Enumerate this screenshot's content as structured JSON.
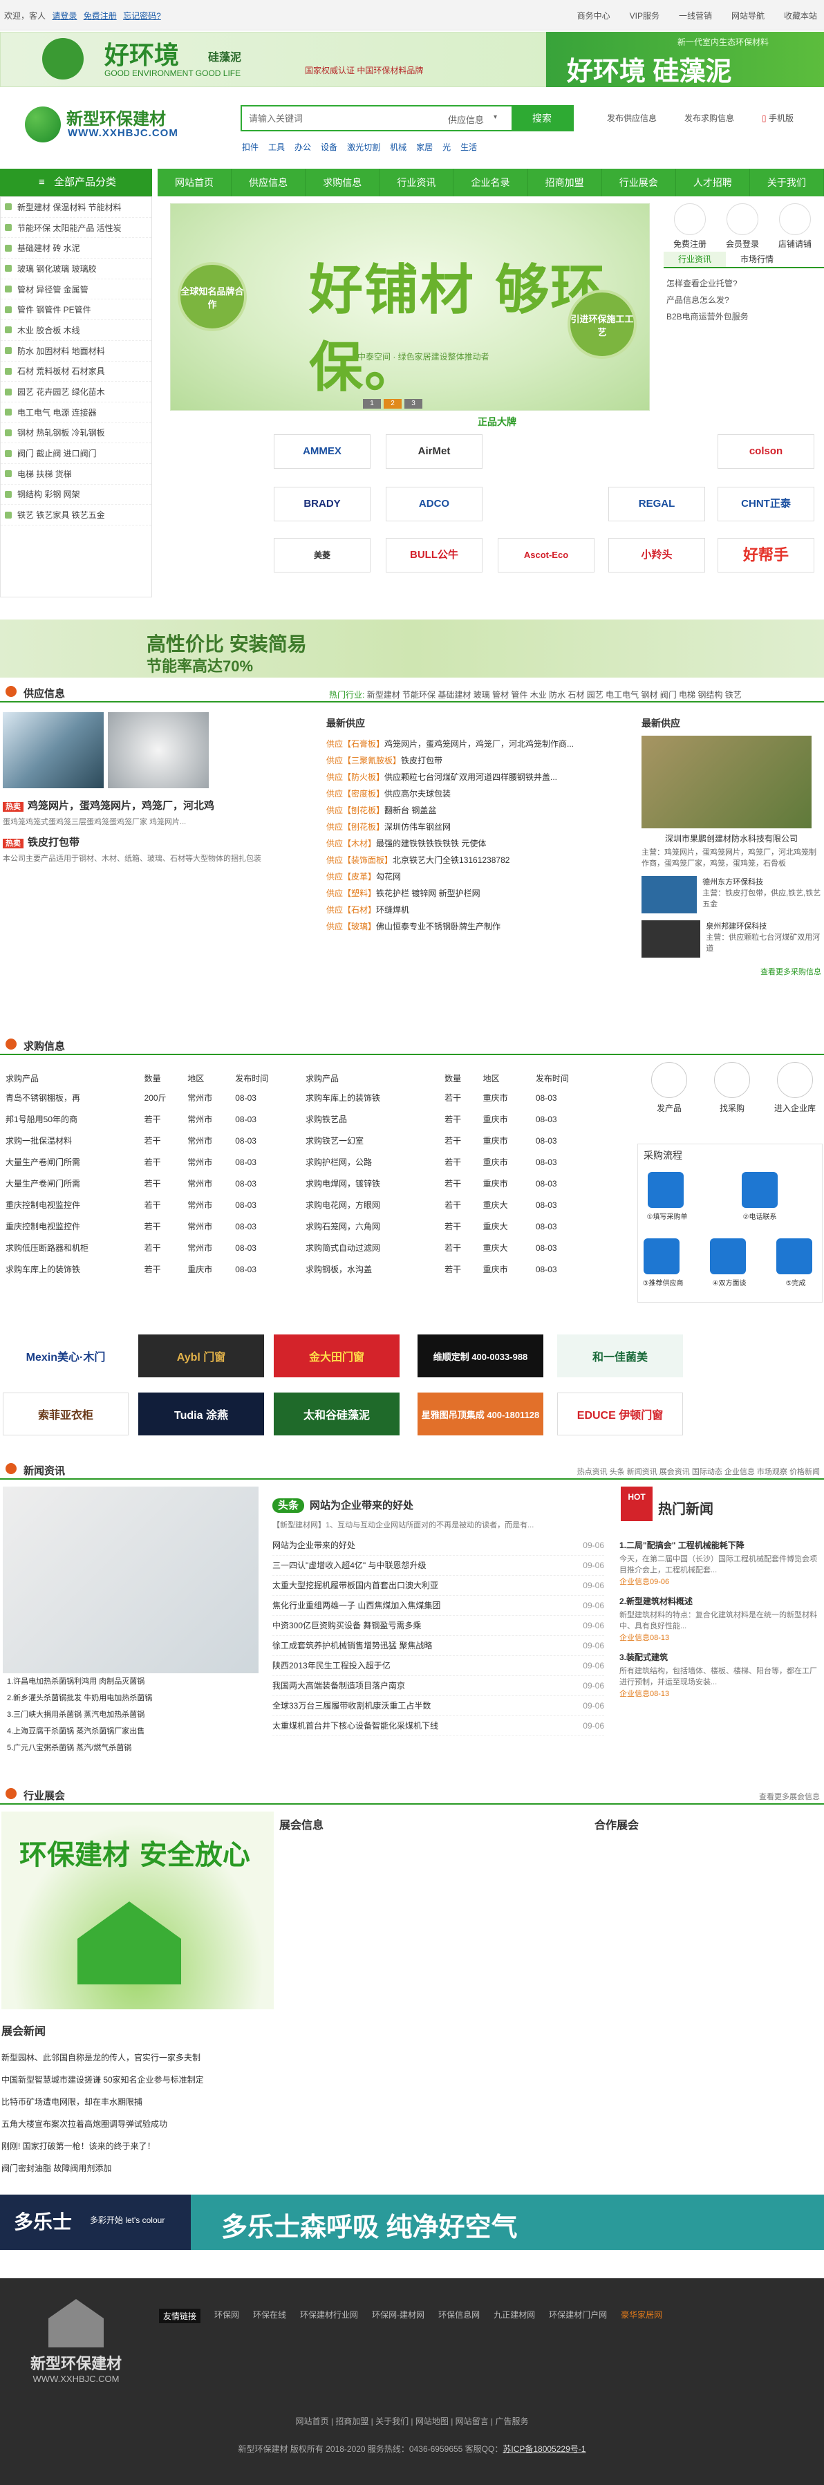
{
  "topbar": {
    "welcome": "欢迎，客人",
    "login": "请登录",
    "register": "免费注册",
    "forgot": "忘记密码?",
    "links": [
      "商务中心",
      "VIP服务",
      "一线营销",
      "网站导航",
      "收藏本站"
    ]
  },
  "ad_top": {
    "left_brand": "好环境",
    "left_sub": "硅藻泥",
    "left_en": "GOOD ENVIRONMENT GOOD LIFE",
    "left_note": "国家权威认证 中国环保材料品牌",
    "right_title": "好环境  硅藻泥",
    "right_sub": "新一代室内生态环保材料"
  },
  "header": {
    "logo_name": "新型环保建材",
    "logo_url": "WWW.XXHBJC.COM",
    "search_placeholder": "请输入关键词",
    "search_select": "供应信息",
    "search_btn": "搜索",
    "hot": [
      "扣件",
      "工具",
      "办公",
      "设备",
      "激光切割",
      "机械",
      "家居",
      "光",
      "生活"
    ],
    "actions": [
      "发布供应信息",
      "发布求购信息",
      "手机版"
    ]
  },
  "nav": {
    "category": "全部产品分类",
    "items": [
      "网站首页",
      "供应信息",
      "求购信息",
      "行业资讯",
      "企业名录",
      "招商加盟",
      "行业展会",
      "人才招聘",
      "关于我们"
    ]
  },
  "sidebar": [
    {
      "label": "新型建材  保温材料  节能材料"
    },
    {
      "label": "节能环保  太阳能产品  活性炭"
    },
    {
      "label": "基础建材  砖  水泥"
    },
    {
      "label": "玻璃  钢化玻璃  玻璃胶"
    },
    {
      "label": "管材  异径管  金属管"
    },
    {
      "label": "管件  钢管件  PE管件"
    },
    {
      "label": "木业  胶合板  木线"
    },
    {
      "label": "防水  加固材料  地面材料"
    },
    {
      "label": "石材  荒料板材  石材家具"
    },
    {
      "label": "园艺  花卉园艺  绿化苗木"
    },
    {
      "label": "电工电气  电源  连接器"
    },
    {
      "label": "钢材  热轧钢板  冷轧钢板"
    },
    {
      "label": "阀门  截止阀  进口阀门"
    },
    {
      "label": "电梯  扶梯  货梯"
    },
    {
      "label": "钢结构  彩钢  网架"
    },
    {
      "label": "铁艺  铁艺家具  铁艺五金"
    }
  ],
  "banner": {
    "headline": "好铺材  够环保。",
    "sub": "中泰空间 · 绿色家居建设整体推动者",
    "left_circle": "全球知名品牌合作",
    "right_circle": "引进环保施工工艺",
    "dots": [
      "1",
      "2",
      "3"
    ]
  },
  "right_box": {
    "icons": [
      "免费注册",
      "会员登录",
      "店铺请铺"
    ],
    "tabs": [
      "行业资讯",
      "市场行情"
    ],
    "items": [
      "怎样查看企业托管?",
      "产品信息怎么发?",
      "B2B电商运营外包服务"
    ]
  },
  "brands_title": "正品大牌",
  "brands": [
    "AMMEX",
    "AirMet",
    "colson",
    "BRADY",
    "ADCO",
    "REGAL",
    "CHNT正泰",
    "美菱",
    "BULL公牛",
    "Ascot-Eco",
    "小羚头",
    "好帮手"
  ],
  "ad_strip": {
    "l1": "高性价比  安装简易",
    "l2": "节能率高达70%"
  },
  "supply": {
    "title": "供应信息",
    "hot_label": "热门行业:",
    "hot": [
      "新型建材",
      "节能环保",
      "基础建材",
      "玻璃",
      "管材",
      "管件",
      "木业",
      "防水",
      "石材",
      "园艺",
      "电工电气",
      "钢材",
      "阀门",
      "电梯",
      "钢结构",
      "铁艺"
    ],
    "featured": [
      {
        "tag": "热卖",
        "title": "鸡笼网片，蛋鸡笼网片，鸡笼厂，河北鸡",
        "desc": "蛋鸡笼鸡笼式蛋鸡笼三层蛋鸡笼蛋鸡笼厂家 鸡笼网片..."
      },
      {
        "tag": "热卖",
        "title": "铁皮打包带",
        "desc": "本公司主要产品适用于钢材、木材、纸箱、玻璃、石材等大型物体的捆扎包装"
      }
    ],
    "latest_title": "最新供应",
    "latest": [
      {
        "cat": "石膏板",
        "t": "鸡笼网片，蛋鸡笼网片，鸡笼厂，河北鸡笼制作商..."
      },
      {
        "cat": "三聚氰胺板",
        "t": "铁皮打包带"
      },
      {
        "cat": "防火板",
        "t": "供应颗粒七台河煤矿双用河道四样腰钢铁井盖..."
      },
      {
        "cat": "密度板",
        "t": "供应高尔夫球包装"
      },
      {
        "cat": "刨花板",
        "t": "翻新台 钢盖盆"
      },
      {
        "cat": "刨花板",
        "t": "深圳仿伟车钢丝网"
      },
      {
        "cat": "木材",
        "t": "最强的建铁铁铁铁铁铁 元使体"
      },
      {
        "cat": "装饰面板",
        "t": "北京铁艺大门全铁13161238782"
      },
      {
        "cat": "皮革",
        "t": "勾花网"
      },
      {
        "cat": "塑料",
        "t": "铁花护栏 镀锌网 新型护栏网"
      },
      {
        "cat": "石材",
        "t": "环缝焊机"
      },
      {
        "cat": "玻璃",
        "t": "佛山恒泰专业不锈钢卧牌生产制作"
      }
    ],
    "right_title": "最新供应",
    "right_main": "深圳市果鹏创建材防水科技有限公司",
    "right_desc": "主营：鸡笼网片，蛋鸡笼网片，鸡笼厂，河北鸡笼制作商，蛋鸡笼厂家，鸡笼，蛋鸡笼，石骨板",
    "right_items": [
      {
        "n": "德州东方环保科技",
        "d": "主营：铁皮打包带，供应,铁艺,铁艺五金"
      },
      {
        "n": "泉州邦建环保科技",
        "d": "主营：供应颗粒七台河煤矿双用河道"
      }
    ],
    "more": "查看更多采购信息"
  },
  "purchase": {
    "title": "求购信息",
    "headers": [
      "求购产品",
      "数量",
      "地区",
      "发布时间"
    ],
    "left": [
      [
        "青岛不锈钢棚板，再",
        "200斤",
        "常州市",
        "08-03"
      ],
      [
        "邦1号船用50年的商",
        "若干",
        "常州市",
        "08-03"
      ],
      [
        "求购一批保温材料",
        "若干",
        "常州市",
        "08-03"
      ],
      [
        "大量生产卷闸门所需",
        "若干",
        "常州市",
        "08-03"
      ],
      [
        "大量生产卷闸门所需",
        "若干",
        "常州市",
        "08-03"
      ],
      [
        "重庆控制电视监控件",
        "若干",
        "常州市",
        "08-03"
      ],
      [
        "重庆控制电视监控件",
        "若干",
        "常州市",
        "08-03"
      ],
      [
        "求购低压断路器和机柜",
        "若干",
        "常州市",
        "08-03"
      ],
      [
        "求购车库上的装饰铁",
        "若干",
        "重庆市",
        "08-03"
      ]
    ],
    "right": [
      [
        "求购车库上的装饰铁",
        "若干",
        "重庆市",
        "08-03"
      ],
      [
        "求购铁艺品",
        "若干",
        "重庆市",
        "08-03"
      ],
      [
        "求购铁艺一幻室",
        "若干",
        "重庆市",
        "08-03"
      ],
      [
        "求购护栏网，公路",
        "若干",
        "重庆市",
        "08-03"
      ],
      [
        "求购电焊网，镀锌铁",
        "若干",
        "重庆市",
        "08-03"
      ],
      [
        "求购电花网，方眼网",
        "若干",
        "重庆大",
        "08-03"
      ],
      [
        "求购石笼网，六角网",
        "若干",
        "重庆大",
        "08-03"
      ],
      [
        "求购简式自动过滤网",
        "若干",
        "重庆大",
        "08-03"
      ],
      [
        "求购钢板，水沟盖",
        "若干",
        "重庆市",
        "08-03"
      ]
    ],
    "actions": [
      "发产品",
      "找采购",
      "进入企业库"
    ],
    "process_title": "采购流程",
    "process": [
      "①填写采购单",
      "②电话联系",
      "③推荐供应商",
      "④双方面谈",
      "⑤完成"
    ]
  },
  "logos": [
    "Mexin美心·木门",
    "Aybl 门窗",
    "金大田门窗",
    "维顺定制 400-0033-988",
    "和一佳菌美",
    "索菲亚衣柜",
    "Tudia 涂燕",
    "太和谷硅藻泥",
    "星雅图吊顶集成 400-1801128",
    "EDUCE 伊顿门窗"
  ],
  "news": {
    "title": "新闻资讯",
    "tags": [
      "热点资讯",
      "头条",
      "新闻资讯",
      "展会资讯",
      "国际动态",
      "企业信息",
      "市场观察",
      "价格新闻"
    ],
    "headline_tag": "头条",
    "headline": "网站为企业带来的好处",
    "headline_desc": "【新型建材网】1、互动与互动企业网站所面对的不再是被动的读者，而是有...",
    "left_list": [
      "1.许昌电加热杀菌锅利鸿用 肉制品灭菌锅",
      "2.新乡灌头杀菌锅批发 牛奶用电加热杀菌锅",
      "3.三门峡大捐用杀菌锅 蒸汽电加热杀菌锅",
      "4.上海豆腐干杀菌锅 蒸汽杀菌锅厂家出售",
      "5.广元八宝粥杀菌锅 蒸汽/燃气杀菌锅"
    ],
    "mid_list": [
      {
        "t": "网站为企业带来的好处",
        "d": "09-06"
      },
      {
        "t": "三一四认\"虚增收入超4亿\" 与中联恩怨升级",
        "d": "09-06"
      },
      {
        "t": "太重大型挖掘机履带板国内首套出口澳大利亚",
        "d": "09-06"
      },
      {
        "t": "焦化行业重组两雄一子 山西焦煤加入焦煤集团",
        "d": "09-06"
      },
      {
        "t": "中资300亿巨资购买设备 舞钢盈亏需多乘",
        "d": "09-06"
      },
      {
        "t": "徐工成套筑养护机械销售增势迅猛 聚焦战略",
        "d": "09-06"
      },
      {
        "t": "陕西2013年民生工程投入超于亿",
        "d": "09-06"
      },
      {
        "t": "我国两大高端装备制造项目落户南京",
        "d": "09-06"
      },
      {
        "t": "全球33万台三履履带收割机康沃重工占半数",
        "d": "09-06"
      },
      {
        "t": "太重煤机首台井下核心设备智能化采煤机下线",
        "d": "09-06"
      }
    ],
    "hot_title": "热门新闻",
    "hot": [
      {
        "t": "1.二局\"配搞会\" 工程机械能耗下降",
        "d": "今天，在第二届中国（长沙）国际工程机械配套件博览会项目推介会上，工程机械配套..."
      },
      {
        "t": "2.新型建筑材料概述",
        "d": "新型建筑材料的特点：复合化建筑材料是在统一的新型材料中、具有良好性能..."
      },
      {
        "t": "3.装配式建筑",
        "d": "所有建筑结构，包括墙体、楼板、楼梯、阳台等，都在工厂进行预制，并运至现场安装..."
      }
    ],
    "hot_dates": [
      "企业信息09-06",
      "企业信息08-13",
      "企业信息08-13"
    ]
  },
  "expo": {
    "title": "行业展会",
    "more": "查看更多展会信息",
    "banner": "环保建材  安全放心",
    "info_title": "展会信息",
    "partner_title": "合作展会",
    "news_title": "展会新闻",
    "news": [
      "新型园林、此邻国自称是龙的传人，官实行一家多夫制",
      "中国新型智慧城市建设搓谦 50家知名企业参与标准制定",
      "比特币矿场遭电网限，却在丰水期限捕",
      "五角大楼宣布案次拉着高炮圈调导弹试验成功",
      "刚刚! 国家打破第一枪！该来的终于来了！",
      "阀门密封油脂 故障阀用剂添加"
    ]
  },
  "ad_bottom": {
    "brand": "多乐士",
    "slogan": "多彩开始 let's colour",
    "title": "多乐士森呼吸  纯净好空气"
  },
  "footer": {
    "logo_name": "新型环保建材",
    "logo_url": "WWW.XXHBJC.COM",
    "links_label": "友情链接",
    "links": [
      "环保网",
      "环保在线",
      "环保建材行业网",
      "环保网-建材网",
      "环保信息网",
      "九正建材网",
      "环保建材门户网",
      "豪华家居网"
    ],
    "bottom": [
      "网站首页",
      "招商加盟",
      "关于我们",
      "网站地图",
      "网站留言",
      "广告服务"
    ],
    "copyright": "新型环保建材  版权所有 2018-2020  服务热线：0436-6959655  客服QQ：",
    "icp": "苏ICP备18005229号-1"
  }
}
